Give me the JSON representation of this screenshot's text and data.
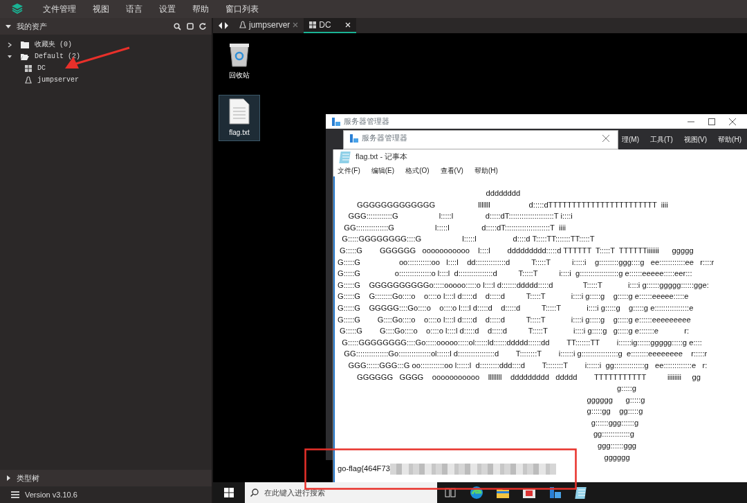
{
  "menubar": {
    "items": [
      "文件管理",
      "视图",
      "语言",
      "设置",
      "帮助",
      "窗口列表"
    ]
  },
  "asset_panel": {
    "title": "我的资产",
    "expanded": true,
    "tree": [
      {
        "label": "收藏夹 (0)",
        "kind": "folder",
        "expanded": false
      },
      {
        "label": "Default (2)",
        "kind": "folder",
        "expanded": true,
        "children": [
          {
            "label": "DC",
            "kind": "windows"
          },
          {
            "label": "jumpserver",
            "kind": "linux"
          }
        ]
      }
    ]
  },
  "type_tree": {
    "title": "类型树",
    "expanded": false
  },
  "version": "Version v3.10.6",
  "tabs": [
    {
      "label": "jumpserver",
      "kind": "linux",
      "selected": false
    },
    {
      "label": "DC",
      "kind": "windows",
      "selected": true
    }
  ],
  "desktop_icons": [
    {
      "label": "回收站",
      "kind": "recycle-bin",
      "selected": false
    },
    {
      "label": "flag.txt",
      "kind": "text-file",
      "selected": true
    }
  ],
  "server_manager": {
    "title": "服务器管理器",
    "menu": [
      "理(M)",
      "工具(T)",
      "视图(V)",
      "帮助(H)"
    ]
  },
  "server_manager_dialog": {
    "title": "服务器管理器"
  },
  "notepad": {
    "title": "flag.txt - 记事本",
    "menu": [
      "文件(F)",
      "编辑(E)",
      "格式(O)",
      "查看(V)",
      "帮助(H)"
    ],
    "lines": [
      "                                                                     dddddddd",
      "         GGGGGGGGGGGGG                    lllllll                  d:::::dTTTTTTTTTTTTTTTTTTTTTTT  iiii",
      "     GGG::::::::::::G                   l:::::l               d:::::dT:::::::::::::::::::::T i::::i",
      "   GG:::::::::::::::G                   l:::::l               d:::::dT:::::::::::::::::::::T  iiii",
      "  G:::::GGGGGGGG::::G                   l:::::l                 d::::d T:::::TT:::::::TT:::::T",
      " G:::::G        GGGGGG   ooooooooooo    l::::l        ddddddddd:::::d TTTTTT  T:::::T  TTTTTTiiiiiii      ggggg",
      "G:::::G                  oo:::::::::::oo   l::::l    dd::::::::::::::d          T:::::T          i:::::i    g:::::::::ggg::::g   ee::::::::::::ee   r::::r",
      "G:::::G                o:::::::::::::::o l::::l  d::::::::::::::::d          T:::::T          i::::i  g::::::::::::::::::g e::::::eeeee:::::eer:::",
      "G:::::G    GGGGGGGGGGo:::::ooooo:::::o l::::l d:::::::ddddd:::::d              T:::::T            i::::i g::::::ggggg::::::gge:",
      "G:::::G    G::::::::Go::::o    o::::o l::::l d:::::d    d:::::d          T:::::T            i::::i g:::::g    g:::::g e::::::eeeee:::::e",
      "G:::::G    GGGGG::::Go::::o    o::::o l::::l d:::::d    d:::::d          T:::::T            i::::i g:::::g    g:::::g e::::::::::::::::e",
      "G:::::G        G::::Go::::o    o::::o l::::l d:::::d    d:::::d          T:::::T            i::::i g:::::g    g:::::g e::::::eeeeeeeee",
      " G:::::G        G::::Go::::o    o::::o l::::l d:::::d    d:::::d          T:::::T            i::::i g:::::g   g:::::g e:::::::e            r:",
      "  G:::::GGGGGGGG::::Go:::::ooooo:::::ol::::::ld::::::ddddd::::::dd        TT:::::::TT        i::::::ig::::::ggggg:::::g e::::",
      "   GG:::::::::::::::Go:::::::::::::::ol::::::l d:::::::::::::::::d        T::::::::T        i::::::i g:::::::::::::::::g  e::::::::eeeeeeee    r:::::r",
      "     GGG::::::GGG:::G oo:::::::::::oo l::::::l  d:::::::::ddd::::d        T::::::::T        i::::::i  gg::::::::::::::g   ee:::::::::::::e   r:",
      "         GGGGGG   GGGG    ooooooooooo    llllllll    ddddddddd   ddddd        TTTTTTTTTTT          iiiiiiii     gg",
      "                                                                                                                                  g:::::g",
      "                                                                                                                    gggggg      g:::::g",
      "                                                                                                                    g:::::gg    gg:::::g",
      "                                                                                                                      g::::::ggg::::::g",
      "                                                                                                                       gg:::::::::::::g",
      "                                                                                                                         ggg::::::ggg",
      "                                                                                                                            gggggg"
    ],
    "flag_prefix": "go-flag{464F73"
  },
  "taskbar": {
    "search_placeholder": "在此键入进行搜索",
    "apps": [
      {
        "kind": "task-view"
      },
      {
        "kind": "browser"
      },
      {
        "kind": "folder"
      },
      {
        "kind": "store"
      },
      {
        "kind": "server-manager"
      },
      {
        "kind": "notepad"
      }
    ]
  }
}
